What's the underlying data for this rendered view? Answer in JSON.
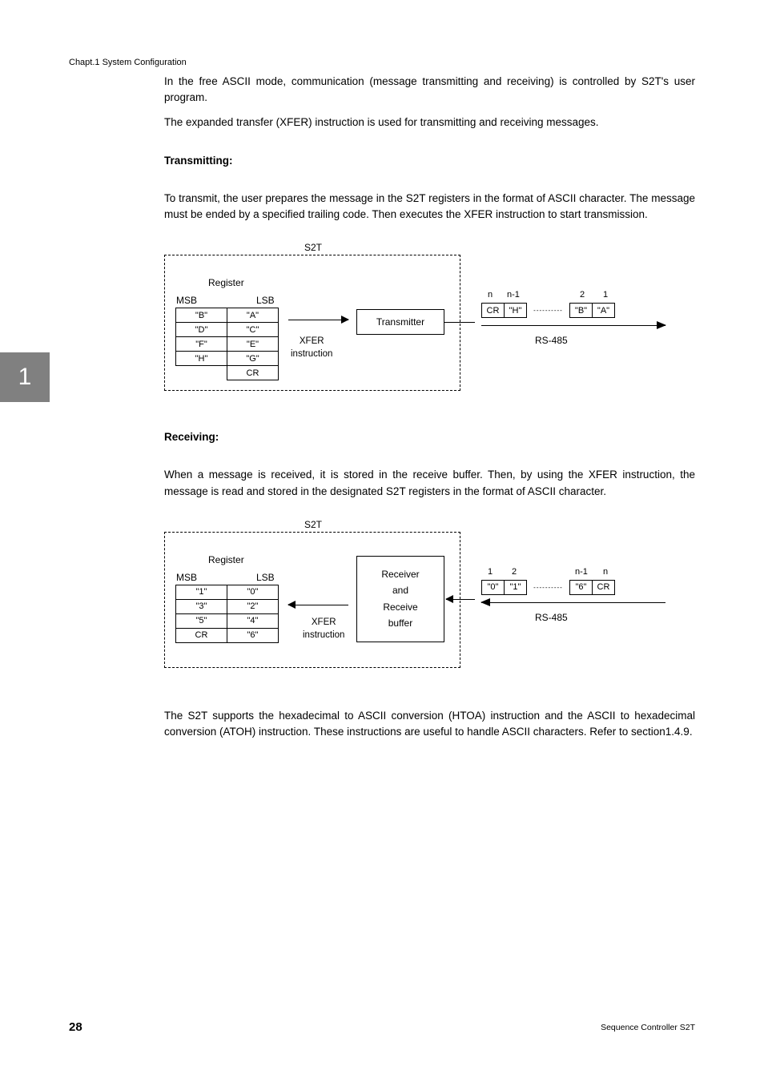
{
  "header": "Chapt.1  System Configuration",
  "sideTab": "1",
  "pageNumber": "28",
  "footer": "Sequence Controller S2T",
  "p1": "In the free ASCII mode, communication (message transmitting and receiving) is controlled by S2T's user program.",
  "p2": "The expanded transfer (XFER) instruction is used for transmitting and receiving messages.",
  "h_transmit": "Transmitting:",
  "p3": "To transmit, the user prepares the message in the S2T registers in the format of ASCII character. The message must be ended by a specified trailing code. Then executes the XFER instruction to start transmission.",
  "h_receive": "Receiving:",
  "p4": "When a message is received, it is stored in the receive buffer. Then, by using the XFER instruction, the message is read and stored in the designated S2T registers in the format of ASCII character.",
  "p5": "The S2T supports the hexadecimal to ASCII conversion (HTOA) instruction and the ASCII to hexadecimal conversion (ATOH) instruction. These instructions are useful to handle ASCII characters. Refer to section1.4.9.",
  "diag": {
    "s2t": "S2T",
    "register": "Register",
    "msb": "MSB",
    "lsb": "LSB",
    "xfer": "XFER",
    "instruction": "instruction",
    "transmitter": "Transmitter",
    "receiver_and_buffer": "Receiver\nand\nReceive\nbuffer",
    "rs485": "RS-485",
    "tx_reg": [
      [
        "\"B\"",
        "\"A\""
      ],
      [
        "\"D\"",
        "\"C\""
      ],
      [
        "\"F\"",
        "\"E\""
      ],
      [
        "\"H\"",
        "\"G\""
      ],
      [
        "",
        "CR"
      ]
    ],
    "rx_reg": [
      [
        "\"1\"",
        "\"0\""
      ],
      [
        "\"3\"",
        "\"2\""
      ],
      [
        "\"5\"",
        "\"4\""
      ],
      [
        "CR",
        "\"6\""
      ]
    ],
    "tx_stream_idx": [
      "n",
      "n-1",
      "2",
      "1"
    ],
    "tx_stream": [
      "CR",
      "\"H\"",
      "\"B\"",
      "\"A\""
    ],
    "rx_stream_idx": [
      "1",
      "2",
      "n-1",
      "n"
    ],
    "rx_stream": [
      "\"0\"",
      "\"1\"",
      "\"6\"",
      "CR"
    ]
  }
}
